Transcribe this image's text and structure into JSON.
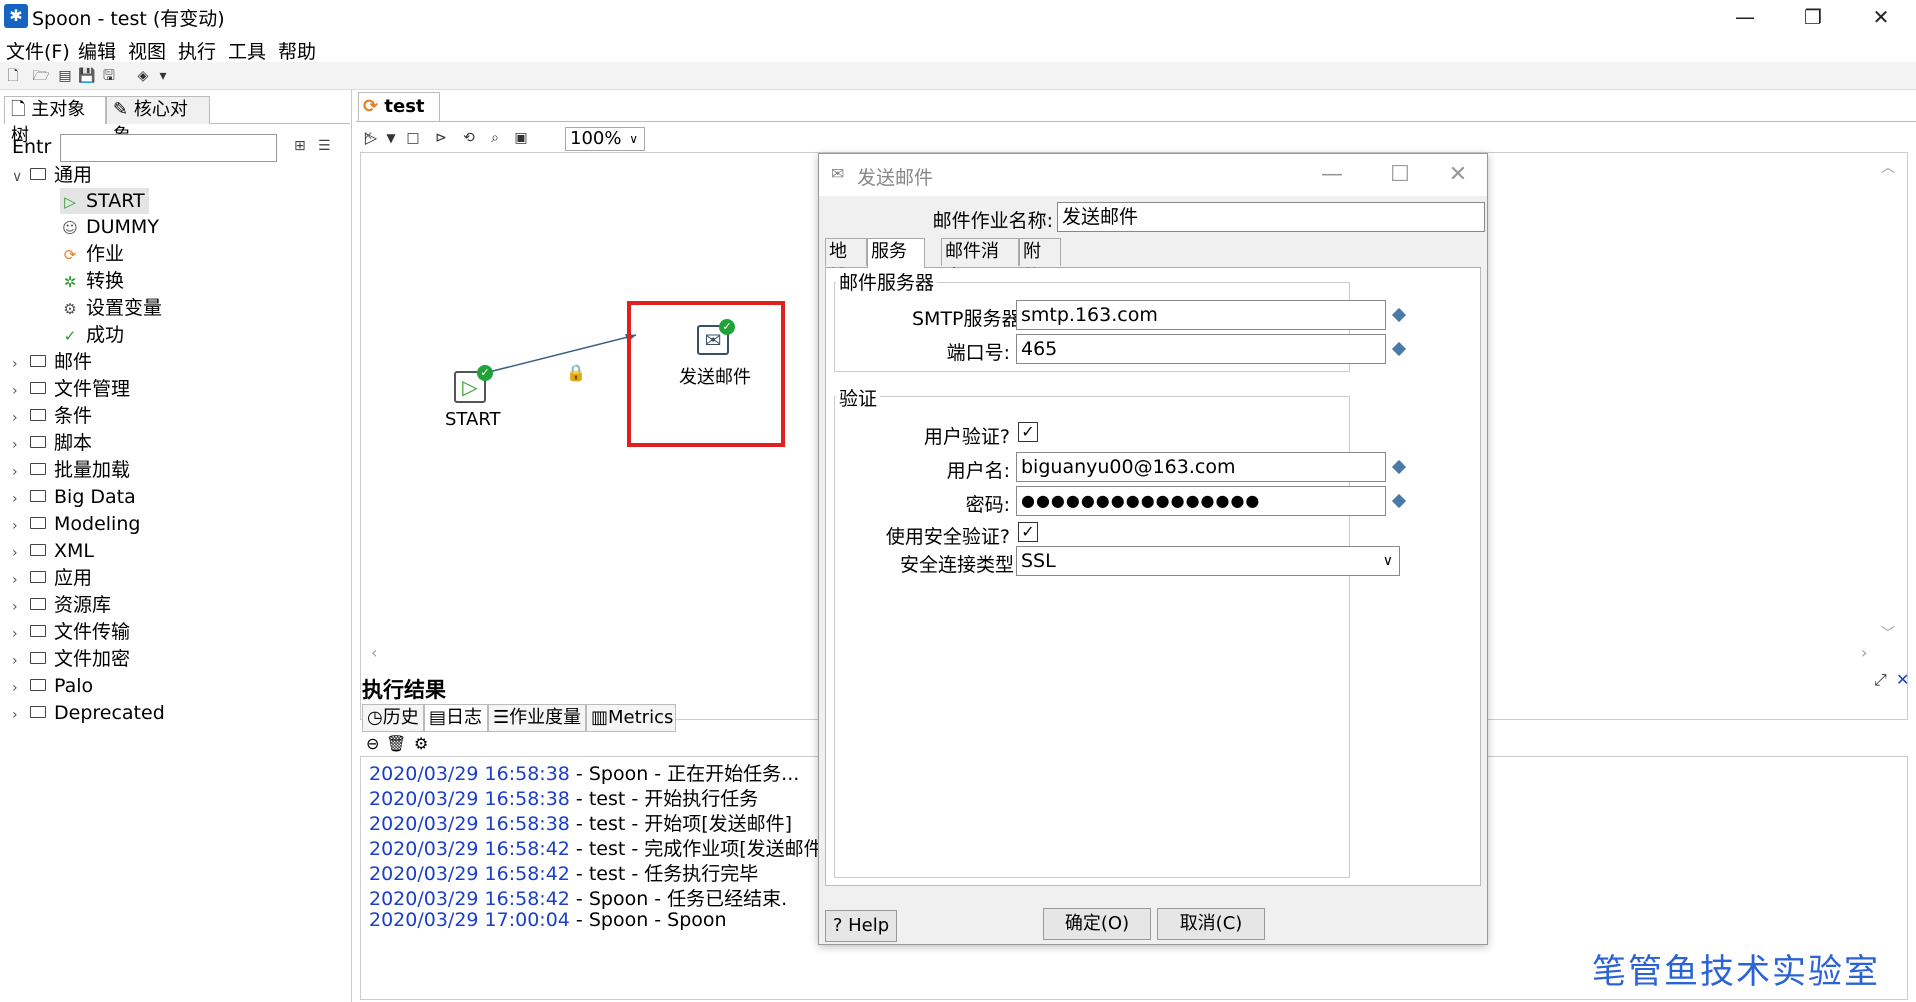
{
  "window": {
    "title": "Spoon - test (有变动)",
    "minimize": "—",
    "restore": "❐",
    "close": "✕"
  },
  "menu": [
    "文件(F)",
    "编辑",
    "视图",
    "执行",
    "工具",
    "帮助"
  ],
  "left": {
    "tabs": [
      "主对象树",
      "核心对象"
    ],
    "filter_label": "Entr",
    "filter_value": "",
    "tree": [
      {
        "label": "通用",
        "type": "folder",
        "expanded": true
      },
      {
        "label": "START",
        "type": "item",
        "icon": "play-icon",
        "selected": true
      },
      {
        "label": "DUMMY",
        "type": "item",
        "icon": "dummy-icon"
      },
      {
        "label": "作业",
        "type": "item",
        "icon": "job-icon"
      },
      {
        "label": "转换",
        "type": "item",
        "icon": "transform-icon"
      },
      {
        "label": "设置变量",
        "type": "item",
        "icon": "variable-icon"
      },
      {
        "label": "成功",
        "type": "item",
        "icon": "check-icon"
      },
      {
        "label": "邮件",
        "type": "folder"
      },
      {
        "label": "文件管理",
        "type": "folder"
      },
      {
        "label": "条件",
        "type": "folder"
      },
      {
        "label": "脚本",
        "type": "folder"
      },
      {
        "label": "批量加载",
        "type": "folder"
      },
      {
        "label": "Big Data",
        "type": "folder"
      },
      {
        "label": "Modeling",
        "type": "folder"
      },
      {
        "label": "XML",
        "type": "folder"
      },
      {
        "label": "应用",
        "type": "folder"
      },
      {
        "label": "资源库",
        "type": "folder"
      },
      {
        "label": "文件传输",
        "type": "folder"
      },
      {
        "label": "文件加密",
        "type": "folder"
      },
      {
        "label": "Palo",
        "type": "folder"
      },
      {
        "label": "Deprecated",
        "type": "folder"
      }
    ]
  },
  "editor": {
    "tab": "test",
    "zoom": "100%",
    "nodes": {
      "start": "START",
      "mail": "发送邮件"
    }
  },
  "results": {
    "title": "执行结果",
    "tabs": [
      "历史",
      "日志",
      "作业度量",
      "Metrics"
    ],
    "log": [
      {
        "ts": "2020/03/29 16:58:38",
        "msg": " - Spoon - 正在开始任务..."
      },
      {
        "ts": "2020/03/29 16:58:38",
        "msg": " - test - 开始执行任务"
      },
      {
        "ts": "2020/03/29 16:58:38",
        "msg": " - test - 开始项[发送邮件]"
      },
      {
        "ts": "2020/03/29 16:58:42",
        "msg": " - test - 完成作业项[发送邮件] (结"
      },
      {
        "ts": "2020/03/29 16:58:42",
        "msg": " - test - 任务执行完毕"
      },
      {
        "ts": "2020/03/29 16:58:42",
        "msg": " - Spoon - 任务已经结束."
      },
      {
        "ts": "2020/03/29 17:00:04",
        "msg": " - Spoon - Spoon"
      }
    ]
  },
  "dialog": {
    "title": "发送邮件",
    "name_label": "邮件作业名称:",
    "name_value": "发送邮件",
    "tabs": [
      "地址",
      "服务器",
      "邮件消息",
      "附件"
    ],
    "server_group": "邮件服务器",
    "smtp_label": "SMTP服务器:",
    "smtp_value": "smtp.163.com",
    "port_label": "端口号:",
    "port_value": "465",
    "auth_group": "验证",
    "user_auth_label": "用户验证?",
    "user_auth_checked": true,
    "username_label": "用户名:",
    "username_value": "biguanyu00@163.com",
    "password_label": "密码:",
    "password_value": "●●●●●●●●●●●●●●●●",
    "secure_auth_label": "使用安全验证?",
    "secure_auth_checked": true,
    "conn_type_label": "安全连接类型",
    "conn_type_value": "SSL",
    "help": "Help",
    "ok": "确定(O)",
    "cancel": "取消(C)"
  },
  "watermark": "笔管鱼技术实验室"
}
